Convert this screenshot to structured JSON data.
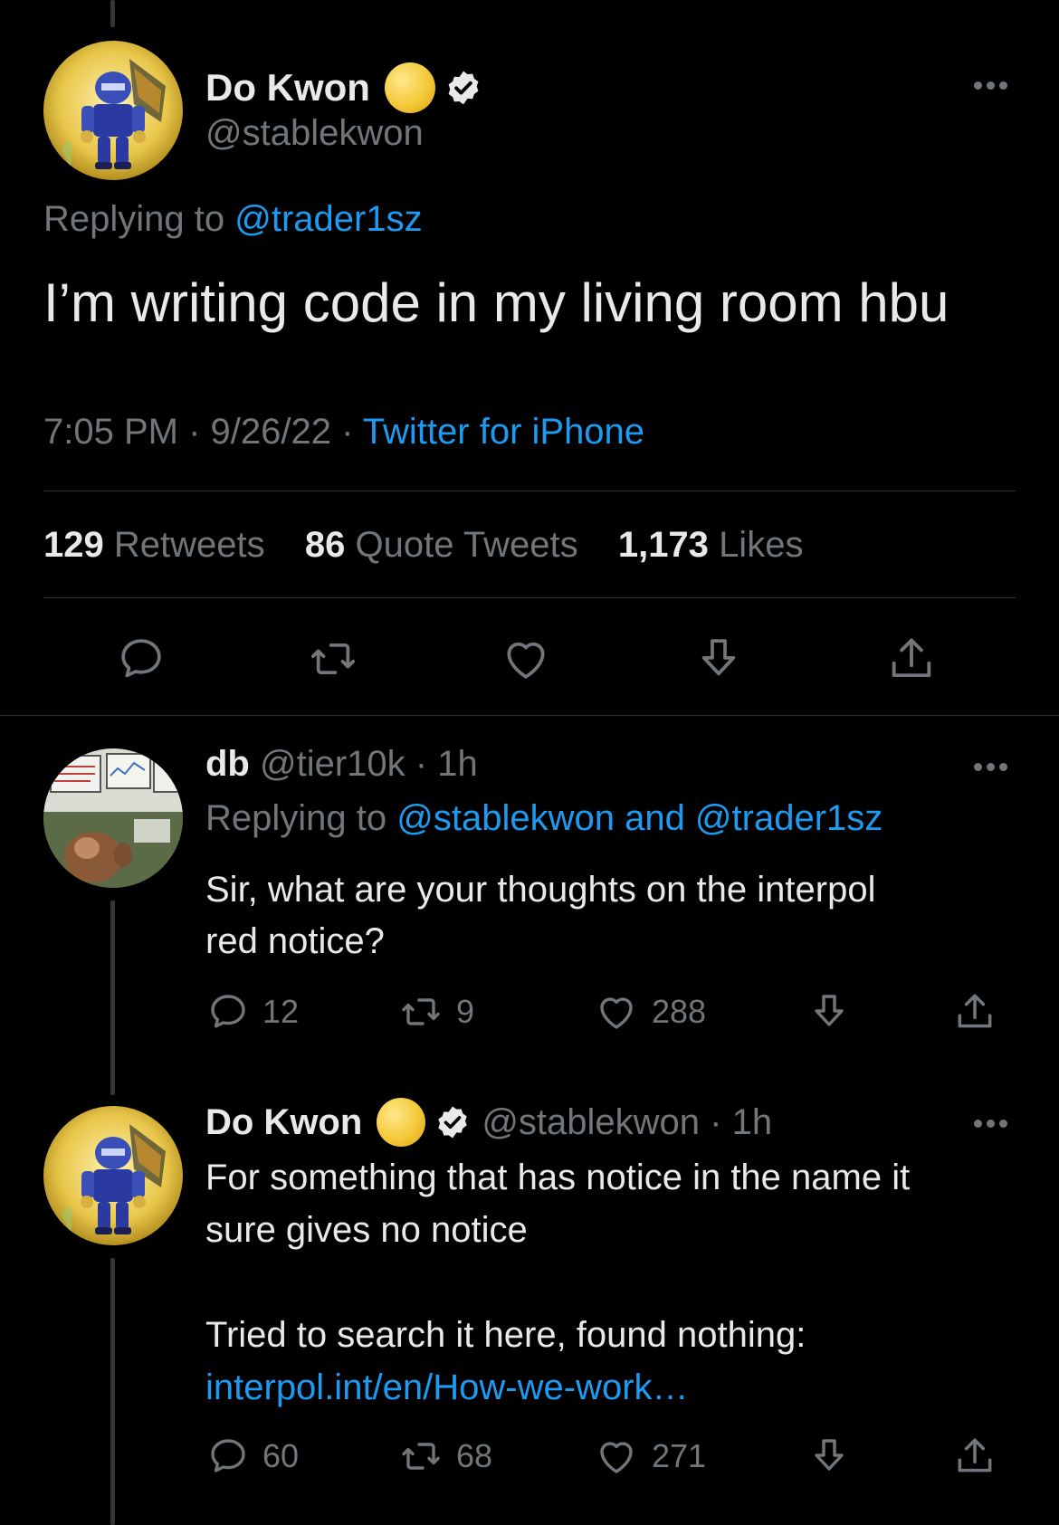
{
  "main_tweet": {
    "author_name": "Do Kwon",
    "handle": "@stablekwon",
    "replying_prefix": "Replying to ",
    "replying_handle": "@trader1sz",
    "text": "I’m writing code in my living room hbu",
    "time": "7:05 PM · 9/26/22 · ",
    "source": "Twitter for iPhone",
    "stats": {
      "retweets_count": "129",
      "retweets_label": "Retweets",
      "quotes_count": "86",
      "quotes_label": "Quote Tweets",
      "likes_count": "1,173",
      "likes_label": "Likes"
    }
  },
  "reply_1": {
    "author_name": "db",
    "meta": "@tier10k · 1h",
    "replying_prefix": "Replying to ",
    "replying_handles": "@stablekwon and @trader1sz",
    "text_line1": "Sir, what are your thoughts on the interpol",
    "text_line2": "red notice?",
    "replies": "12",
    "retweets": "9",
    "likes": "288"
  },
  "reply_2": {
    "author_name": "Do Kwon",
    "meta": "@stablekwon · 1h",
    "text_line1": "For something that has notice in the name it",
    "text_line2": "sure gives no notice",
    "text_line3": "Tried to search it here, found nothing:",
    "link": "interpol.int/en/How-we-work…",
    "replies": "60",
    "retweets": "68",
    "likes": "271"
  },
  "colors": {
    "background": "#000000",
    "text": "#e7e9ea",
    "secondary": "#71767b",
    "link": "#1d9bf0"
  },
  "icons": [
    "reply-icon",
    "retweet-icon",
    "like-icon",
    "bookmark-icon",
    "share-icon",
    "verified-icon",
    "more-icon",
    "moon-emoji-icon"
  ]
}
